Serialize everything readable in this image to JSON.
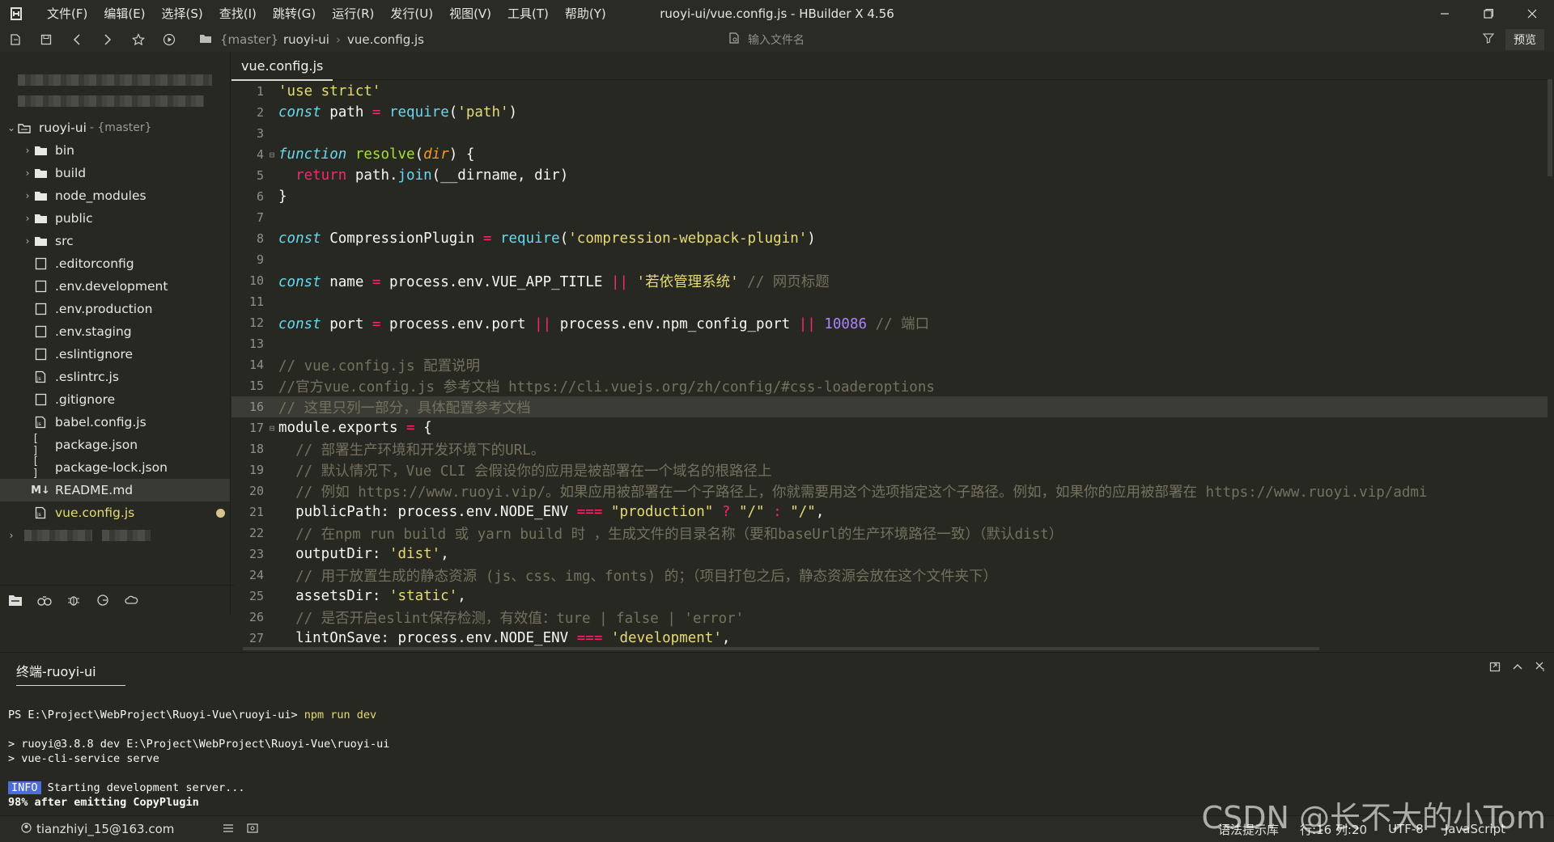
{
  "window": {
    "title": "ruoyi-ui/vue.config.js - HBuilder X 4.56",
    "menu": [
      "文件(F)",
      "编辑(E)",
      "选择(S)",
      "查找(I)",
      "跳转(G)",
      "运行(R)",
      "发行(U)",
      "视图(V)",
      "工具(T)",
      "帮助(Y)"
    ]
  },
  "toolbar": {
    "branch": "{master}",
    "project": "ruoyi-ui",
    "file": "vue.config.js",
    "file_search_placeholder": "输入文件名",
    "preview_label": "预览"
  },
  "sidebar": {
    "root": {
      "name": "ruoyi-ui",
      "branch": "- {master}"
    },
    "items": [
      {
        "label": "bin",
        "type": "folder"
      },
      {
        "label": "build",
        "type": "folder"
      },
      {
        "label": "node_modules",
        "type": "folder"
      },
      {
        "label": "public",
        "type": "folder"
      },
      {
        "label": "src",
        "type": "folder"
      },
      {
        "label": ".editorconfig",
        "type": "file"
      },
      {
        "label": ".env.development",
        "type": "file"
      },
      {
        "label": ".env.production",
        "type": "file"
      },
      {
        "label": ".env.staging",
        "type": "file"
      },
      {
        "label": ".eslintignore",
        "type": "file"
      },
      {
        "label": ".eslintrc.js",
        "type": "js"
      },
      {
        "label": ".gitignore",
        "type": "file"
      },
      {
        "label": "babel.config.js",
        "type": "js"
      },
      {
        "label": "package.json",
        "type": "json"
      },
      {
        "label": "package-lock.json",
        "type": "json"
      },
      {
        "label": "README.md",
        "type": "md"
      },
      {
        "label": "vue.config.js",
        "type": "js"
      }
    ]
  },
  "editor": {
    "tab": "vue.config.js",
    "line_numbers": [
      "1",
      "2",
      "3",
      "4",
      "5",
      "6",
      "7",
      "8",
      "9",
      "10",
      "11",
      "12",
      "13",
      "14",
      "15",
      "16",
      "17",
      "18",
      "19",
      "20",
      "21",
      "22",
      "23",
      "24",
      "25",
      "26",
      "27"
    ]
  },
  "code": {
    "l1": "'use strict'",
    "l2a": "const",
    "l2b": " path ",
    "l2c": "=",
    "l2d": " require",
    "l2e": "(",
    "l2f": "'path'",
    "l2g": ")",
    "l4a": "function",
    "l4b": " resolve",
    "l4c": "(",
    "l4d": "dir",
    "l4e": ") {",
    "l5a": "  return",
    "l5b": " path.",
    "l5c": "join",
    "l5d": "(__dirname, dir)",
    "l6": "}",
    "l8a": "const",
    "l8b": " CompressionPlugin ",
    "l8c": "=",
    "l8d": " require",
    "l8e": "(",
    "l8f": "'compression-webpack-plugin'",
    "l8g": ")",
    "l10a": "const",
    "l10b": " name ",
    "l10c": "=",
    "l10d": " process.env.VUE_APP_TITLE ",
    "l10e": "||",
    "l10f": " '若依管理系统'",
    "l10g": " // 网页标题",
    "l12a": "const",
    "l12b": " port ",
    "l12c": "=",
    "l12d": " process.env.port ",
    "l12e": "||",
    "l12f": " process.env.npm_config_port ",
    "l12g": "||",
    "l12h": " 10086",
    "l12i": " // 端口",
    "l14": "// vue.config.js 配置说明",
    "l15": "//官方vue.config.js 参考文档 https://cli.vuejs.org/zh/config/#css-loaderoptions",
    "l16": "// 这里只列一部分，具体配置参考文档",
    "l17a": "module.exports ",
    "l17b": "=",
    "l17c": " {",
    "l18": "  // 部署生产环境和开发环境下的URL。",
    "l19": "  // 默认情况下，Vue CLI 会假设你的应用是被部署在一个域名的根路径上",
    "l20": "  // 例如 https://www.ruoyi.vip/。如果应用被部署在一个子路径上，你就需要用这个选项指定这个子路径。例如，如果你的应用被部署在 https://www.ruoyi.vip/admi",
    "l21a": "  publicPath: process.env.NODE_ENV ",
    "l21b": "===",
    "l21c": " \"production\"",
    "l21d": " ?",
    "l21e": " \"/\"",
    "l21f": " :",
    "l21g": " \"/\"",
    "l21h": ",",
    "l22": "  // 在npm run build 或 yarn build 时 ，生成文件的目录名称（要和baseUrl的生产环境路径一致）（默认dist）",
    "l23a": "  outputDir: ",
    "l23b": "'dist'",
    "l23c": ",",
    "l24": "  // 用于放置生成的静态资源 (js、css、img、fonts) 的；（项目打包之后，静态资源会放在这个文件夹下）",
    "l25a": "  assetsDir: ",
    "l25b": "'static'",
    "l25c": ",",
    "l26": "  // 是否开启eslint保存检测，有效值：ture | false | 'error'",
    "l27a": "  lintOnSave: process.env.NODE_ENV ",
    "l27b": "===",
    "l27c": " 'development'",
    "l27d": ","
  },
  "terminal": {
    "tab": "终端-ruoyi-ui",
    "prompt": "PS E:\\Project\\WebProject\\Ruoyi-Vue\\ruoyi-ui> ",
    "command": "npm run dev",
    "out1": "> ruoyi@3.8.8 dev E:\\Project\\WebProject\\Ruoyi-Vue\\ruoyi-ui",
    "out2": "> vue-cli-service serve",
    "info_badge": "INFO",
    "out3": " Starting development server...",
    "out4": "98% after emitting CopyPlugin"
  },
  "statusbar": {
    "user": "tianzhiyi_15@163.com",
    "hint": "语法提示库",
    "position": "行:16  列:20",
    "encoding": "UTF-8",
    "language": "JavaScript"
  },
  "watermark": "CSDN @长不大的小Tom",
  "colors": {
    "background": "#272822",
    "string": "#e6db74",
    "keyword": "#66d9ef",
    "operator": "#f92672",
    "function": "#a6e22e",
    "comment": "#75715e",
    "number": "#ae81ff"
  }
}
